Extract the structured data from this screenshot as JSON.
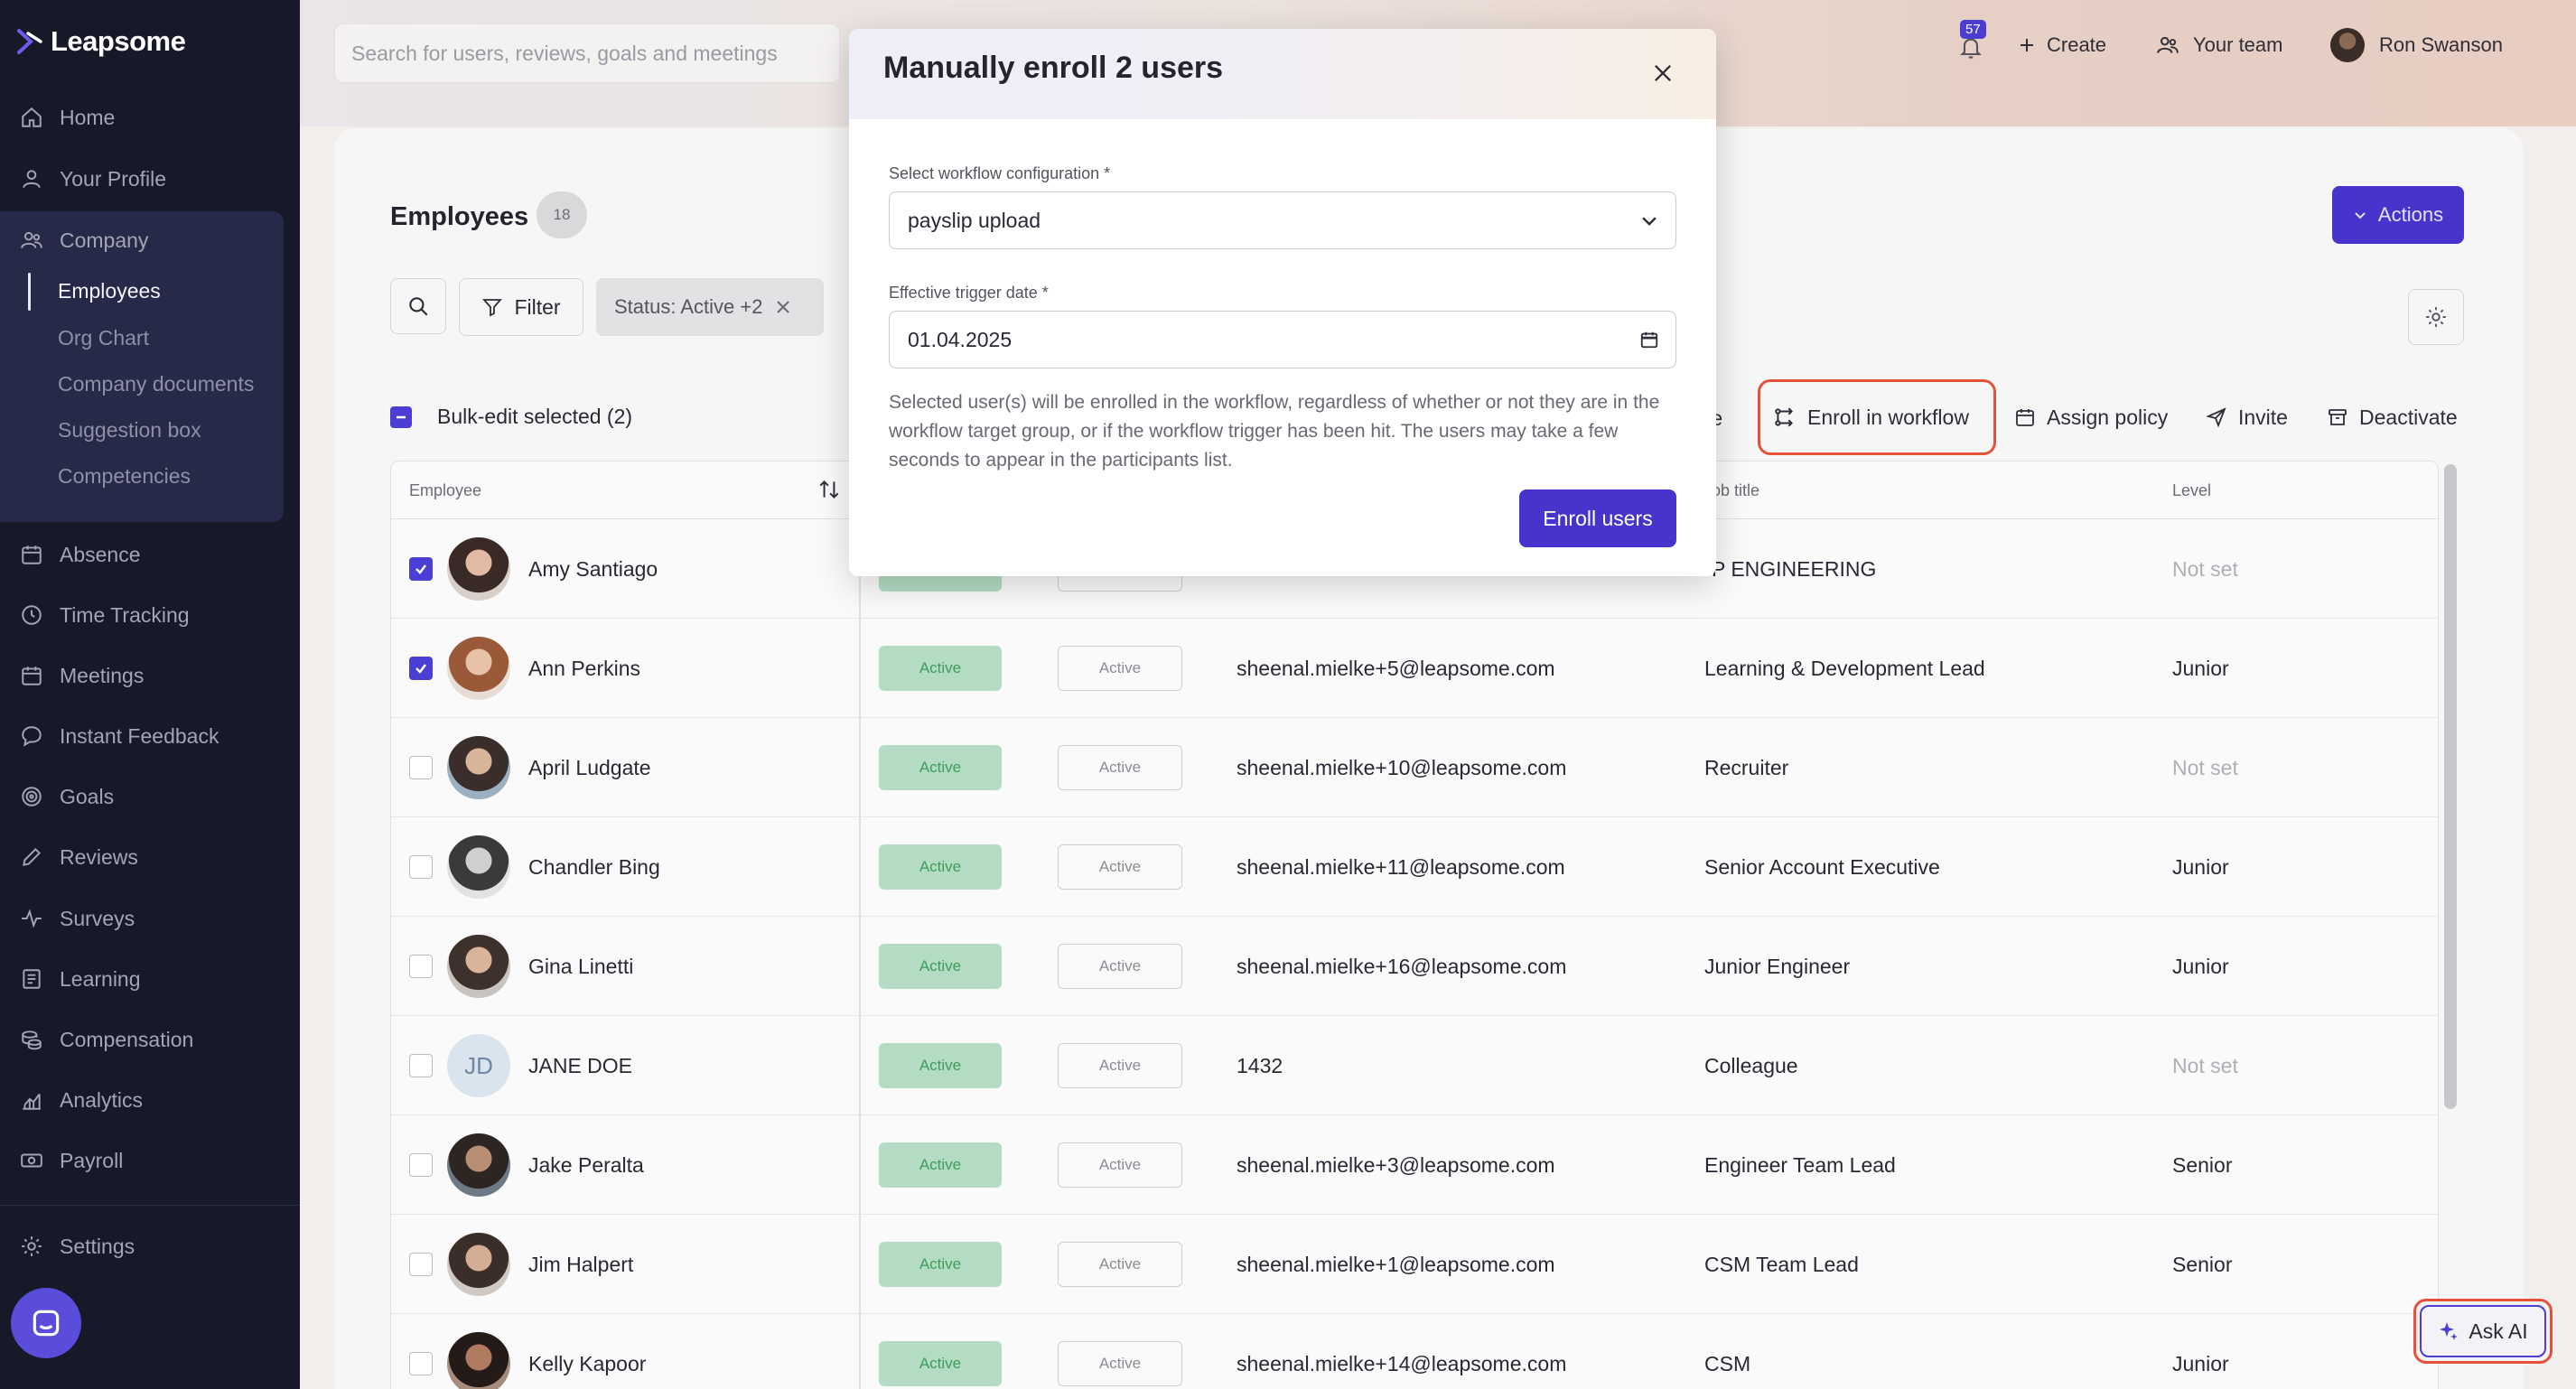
{
  "app": {
    "name": "Leapsome"
  },
  "search": {
    "placeholder": "Search for users, reviews, goals and meetings"
  },
  "header": {
    "notifications_count": "57",
    "create_label": "Create",
    "your_team_label": "Your team",
    "user_name": "Ron Swanson"
  },
  "sidebar": {
    "items": [
      {
        "label": "Home",
        "icon": "home-icon"
      },
      {
        "label": "Your Profile",
        "icon": "user-icon"
      },
      {
        "label": "Company",
        "icon": "people-icon"
      },
      {
        "label": "Absence",
        "icon": "calendar-icon"
      },
      {
        "label": "Time Tracking",
        "icon": "clock-icon"
      },
      {
        "label": "Meetings",
        "icon": "calendar-icon"
      },
      {
        "label": "Instant Feedback",
        "icon": "chat-icon"
      },
      {
        "label": "Goals",
        "icon": "target-icon"
      },
      {
        "label": "Reviews",
        "icon": "pen-icon"
      },
      {
        "label": "Surveys",
        "icon": "pulse-icon"
      },
      {
        "label": "Learning",
        "icon": "book-icon"
      },
      {
        "label": "Compensation",
        "icon": "coins-icon"
      },
      {
        "label": "Analytics",
        "icon": "chart-icon"
      },
      {
        "label": "Payroll",
        "icon": "money-icon"
      }
    ],
    "company_sub": [
      "Employees",
      "Org Chart",
      "Company documents",
      "Suggestion box",
      "Competencies"
    ],
    "settings_label": "Settings"
  },
  "page": {
    "title": "Employees",
    "count": "18",
    "actions_label": "Actions",
    "filter_label": "Filter",
    "status_chip": "Status: Active +2",
    "bulk_label": "Bulk-edit selected (2)",
    "bulk_te": "te",
    "bulk_actions": {
      "enroll": "Enroll in workflow",
      "assign": "Assign policy",
      "invite": "Invite",
      "deactivate": "Deactivate"
    }
  },
  "table": {
    "headers": {
      "employee": "Employee",
      "job_title": "Job title",
      "job_title_visible": "ob title",
      "level": "Level"
    },
    "rows": [
      {
        "name": "Amy Santiago",
        "checked": true,
        "status1": "Active",
        "status2": "Active",
        "email": "",
        "job": "VP ENGINEERING",
        "job_visible": "P ENGINEERING",
        "level": "Not set"
      },
      {
        "name": "Ann Perkins",
        "checked": true,
        "status1": "Active",
        "status2": "Active",
        "email": "sheenal.mielke+5@leapsome.com",
        "job": "Learning & Development Lead",
        "level": "Junior"
      },
      {
        "name": "April Ludgate",
        "checked": false,
        "status1": "Active",
        "status2": "Active",
        "email": "sheenal.mielke+10@leapsome.com",
        "job": "Recruiter",
        "level": "Not set"
      },
      {
        "name": "Chandler Bing",
        "checked": false,
        "status1": "Active",
        "status2": "Active",
        "email": "sheenal.mielke+11@leapsome.com",
        "job": "Senior Account Executive",
        "level": "Junior"
      },
      {
        "name": "Gina Linetti",
        "checked": false,
        "status1": "Active",
        "status2": "Active",
        "email": "sheenal.mielke+16@leapsome.com",
        "job": "Junior Engineer",
        "level": "Junior"
      },
      {
        "name": "JANE DOE",
        "initials": "JD",
        "checked": false,
        "status1": "Active",
        "status2": "Active",
        "email": "1432",
        "job": "Colleague",
        "level": "Not set"
      },
      {
        "name": "Jake Peralta",
        "checked": false,
        "status1": "Active",
        "status2": "Active",
        "email": "sheenal.mielke+3@leapsome.com",
        "job": "Engineer Team Lead",
        "level": "Senior"
      },
      {
        "name": "Jim Halpert",
        "checked": false,
        "status1": "Active",
        "status2": "Active",
        "email": "sheenal.mielke+1@leapsome.com",
        "job": "CSM Team Lead",
        "level": "Senior"
      },
      {
        "name": "Kelly Kapoor",
        "checked": false,
        "status1": "Active",
        "status2": "Active",
        "email": "sheenal.mielke+14@leapsome.com",
        "job": "CSM",
        "level": "Junior"
      }
    ]
  },
  "modal": {
    "title": "Manually enroll 2 users",
    "workflow_label": "Select workflow configuration *",
    "workflow_value": "payslip upload",
    "date_label": "Effective trigger date *",
    "date_value": "01.04.2025",
    "description": "Selected user(s) will be enrolled in the workflow, regardless of whether or not they are in the workflow target group, or if the workflow trigger has been hit. The users may take a few seconds to appear in the participants list.",
    "enroll_button": "Enroll users"
  },
  "ask_ai": {
    "label": "Ask AI"
  },
  "colors": {
    "accent": "#4734cc",
    "sidebar_bg": "#181928",
    "highlight": "#e5523a",
    "active_green": "#b4dcc2"
  }
}
